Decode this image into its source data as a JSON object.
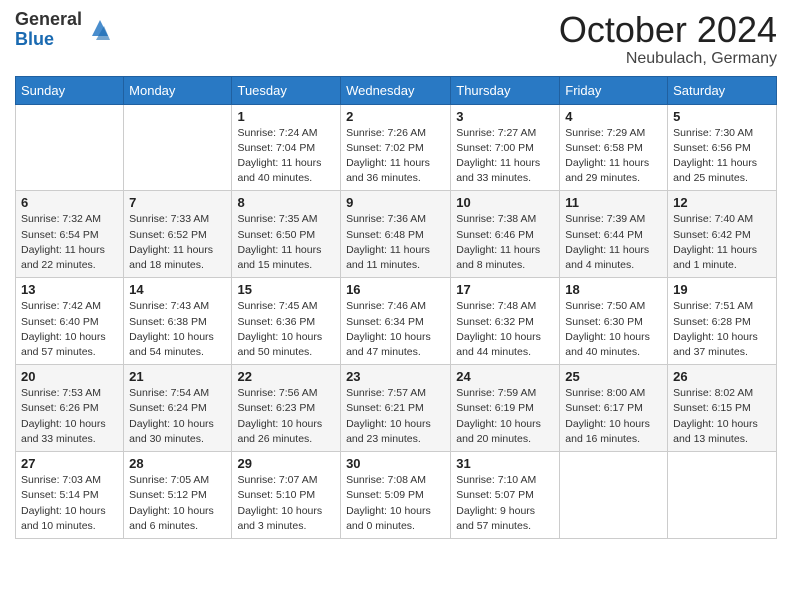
{
  "logo": {
    "general": "General",
    "blue": "Blue"
  },
  "header": {
    "month": "October 2024",
    "location": "Neubulach, Germany"
  },
  "weekdays": [
    "Sunday",
    "Monday",
    "Tuesday",
    "Wednesday",
    "Thursday",
    "Friday",
    "Saturday"
  ],
  "weeks": [
    [
      {
        "day": "",
        "info": ""
      },
      {
        "day": "",
        "info": ""
      },
      {
        "day": "1",
        "info": "Sunrise: 7:24 AM\nSunset: 7:04 PM\nDaylight: 11 hours and 40 minutes."
      },
      {
        "day": "2",
        "info": "Sunrise: 7:26 AM\nSunset: 7:02 PM\nDaylight: 11 hours and 36 minutes."
      },
      {
        "day": "3",
        "info": "Sunrise: 7:27 AM\nSunset: 7:00 PM\nDaylight: 11 hours and 33 minutes."
      },
      {
        "day": "4",
        "info": "Sunrise: 7:29 AM\nSunset: 6:58 PM\nDaylight: 11 hours and 29 minutes."
      },
      {
        "day": "5",
        "info": "Sunrise: 7:30 AM\nSunset: 6:56 PM\nDaylight: 11 hours and 25 minutes."
      }
    ],
    [
      {
        "day": "6",
        "info": "Sunrise: 7:32 AM\nSunset: 6:54 PM\nDaylight: 11 hours and 22 minutes."
      },
      {
        "day": "7",
        "info": "Sunrise: 7:33 AM\nSunset: 6:52 PM\nDaylight: 11 hours and 18 minutes."
      },
      {
        "day": "8",
        "info": "Sunrise: 7:35 AM\nSunset: 6:50 PM\nDaylight: 11 hours and 15 minutes."
      },
      {
        "day": "9",
        "info": "Sunrise: 7:36 AM\nSunset: 6:48 PM\nDaylight: 11 hours and 11 minutes."
      },
      {
        "day": "10",
        "info": "Sunrise: 7:38 AM\nSunset: 6:46 PM\nDaylight: 11 hours and 8 minutes."
      },
      {
        "day": "11",
        "info": "Sunrise: 7:39 AM\nSunset: 6:44 PM\nDaylight: 11 hours and 4 minutes."
      },
      {
        "day": "12",
        "info": "Sunrise: 7:40 AM\nSunset: 6:42 PM\nDaylight: 11 hours and 1 minute."
      }
    ],
    [
      {
        "day": "13",
        "info": "Sunrise: 7:42 AM\nSunset: 6:40 PM\nDaylight: 10 hours and 57 minutes."
      },
      {
        "day": "14",
        "info": "Sunrise: 7:43 AM\nSunset: 6:38 PM\nDaylight: 10 hours and 54 minutes."
      },
      {
        "day": "15",
        "info": "Sunrise: 7:45 AM\nSunset: 6:36 PM\nDaylight: 10 hours and 50 minutes."
      },
      {
        "day": "16",
        "info": "Sunrise: 7:46 AM\nSunset: 6:34 PM\nDaylight: 10 hours and 47 minutes."
      },
      {
        "day": "17",
        "info": "Sunrise: 7:48 AM\nSunset: 6:32 PM\nDaylight: 10 hours and 44 minutes."
      },
      {
        "day": "18",
        "info": "Sunrise: 7:50 AM\nSunset: 6:30 PM\nDaylight: 10 hours and 40 minutes."
      },
      {
        "day": "19",
        "info": "Sunrise: 7:51 AM\nSunset: 6:28 PM\nDaylight: 10 hours and 37 minutes."
      }
    ],
    [
      {
        "day": "20",
        "info": "Sunrise: 7:53 AM\nSunset: 6:26 PM\nDaylight: 10 hours and 33 minutes."
      },
      {
        "day": "21",
        "info": "Sunrise: 7:54 AM\nSunset: 6:24 PM\nDaylight: 10 hours and 30 minutes."
      },
      {
        "day": "22",
        "info": "Sunrise: 7:56 AM\nSunset: 6:23 PM\nDaylight: 10 hours and 26 minutes."
      },
      {
        "day": "23",
        "info": "Sunrise: 7:57 AM\nSunset: 6:21 PM\nDaylight: 10 hours and 23 minutes."
      },
      {
        "day": "24",
        "info": "Sunrise: 7:59 AM\nSunset: 6:19 PM\nDaylight: 10 hours and 20 minutes."
      },
      {
        "day": "25",
        "info": "Sunrise: 8:00 AM\nSunset: 6:17 PM\nDaylight: 10 hours and 16 minutes."
      },
      {
        "day": "26",
        "info": "Sunrise: 8:02 AM\nSunset: 6:15 PM\nDaylight: 10 hours and 13 minutes."
      }
    ],
    [
      {
        "day": "27",
        "info": "Sunrise: 7:03 AM\nSunset: 5:14 PM\nDaylight: 10 hours and 10 minutes."
      },
      {
        "day": "28",
        "info": "Sunrise: 7:05 AM\nSunset: 5:12 PM\nDaylight: 10 hours and 6 minutes."
      },
      {
        "day": "29",
        "info": "Sunrise: 7:07 AM\nSunset: 5:10 PM\nDaylight: 10 hours and 3 minutes."
      },
      {
        "day": "30",
        "info": "Sunrise: 7:08 AM\nSunset: 5:09 PM\nDaylight: 10 hours and 0 minutes."
      },
      {
        "day": "31",
        "info": "Sunrise: 7:10 AM\nSunset: 5:07 PM\nDaylight: 9 hours and 57 minutes."
      },
      {
        "day": "",
        "info": ""
      },
      {
        "day": "",
        "info": ""
      }
    ]
  ]
}
